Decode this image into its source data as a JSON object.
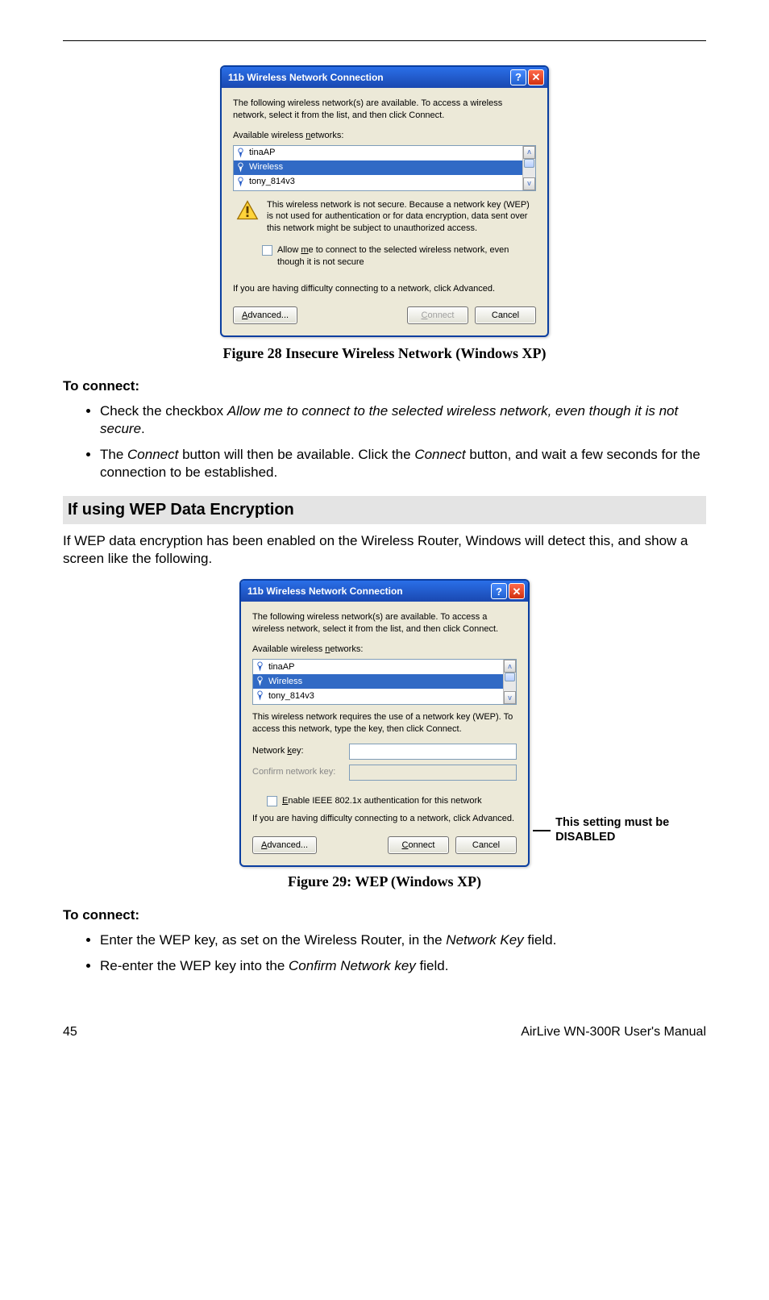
{
  "dialog": {
    "title": "11b Wireless Network Connection",
    "help_char": "?",
    "close_char": "✕",
    "intro": "The following wireless network(s) are available. To access a wireless network, select it from the list, and then click Connect.",
    "list_pre": "Available wireless ",
    "list_n": "n",
    "list_post": "etworks:",
    "items": {
      "0": "tinaAP",
      "1": "Wireless",
      "2": "tony_814v3"
    },
    "scroll_up": "ʌ",
    "scroll_down": "v",
    "warning": "This wireless network is not secure. Because a network key (WEP) is not used for authentication or for data encryption, data sent over this network might be subject to unauthorized access.",
    "check_pre": "Allow ",
    "check_m": "m",
    "check_post": "e to connect to the selected wireless network, even though it is not secure",
    "advice": "If you are having difficulty connecting to a network, click Advanced.",
    "btn_adv_pre": "A",
    "btn_adv_post": "dvanced...",
    "btn_con_pre": "C",
    "btn_con_post": "onnect",
    "btn_cancel": "Cancel"
  },
  "caption1": "Figure 28 Insecure Wireless Network (Windows XP)",
  "sec1": {
    "heading": "To connect:",
    "b1_pre": "Check the checkbox ",
    "b1_em": "Allow me to connect to the selected wireless network, even though it is not secure",
    "b1_post": ".",
    "b2_pre": "The ",
    "b2_em1": "Connect",
    "b2_mid": " button will then be available. Click the ",
    "b2_em2": "Connect",
    "b2_post": " button, and wait a few seconds for the connection to be established."
  },
  "section_heading": "If using WEP Data Encryption",
  "paragraph2": "If WEP data encryption has been enabled on the Wireless Router, Windows will detect this, and show a screen like the following.",
  "dialog2": {
    "title": "11b Wireless Network Connection",
    "key_info": "This wireless network requires the use of a network key (WEP). To access this network, type the key, then click Connect.",
    "keylbl_pre": "Network ",
    "keylbl_k": "k",
    "keylbl_post": "ey:",
    "confirm_lbl": "Confirm network key:",
    "ieee_pre": "E",
    "ieee_post": "nable IEEE 802.1x authentication for this network"
  },
  "callout": "This setting must be DISABLED",
  "caption2": "Figure 29: WEP (Windows XP)",
  "sec2": {
    "heading": "To connect:",
    "b1_pre": "Enter the WEP key, as set on the Wireless Router, in the ",
    "b1_em": "Network Key",
    "b1_post": " field.",
    "b2_pre": "Re-enter the WEP key into the ",
    "b2_em": "Confirm Network key",
    "b2_post": " field."
  },
  "footer": {
    "page": "45",
    "doc": "AirLive WN-300R User's Manual"
  }
}
